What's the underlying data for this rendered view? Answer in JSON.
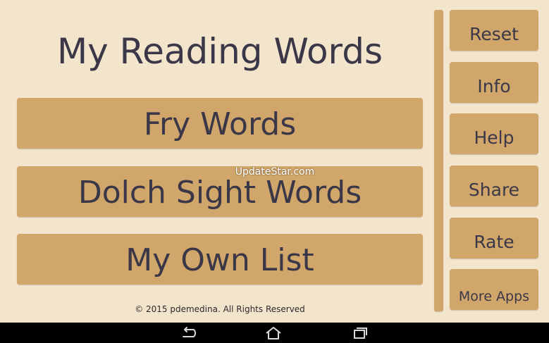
{
  "app": {
    "title": "My Reading Words",
    "main_buttons": [
      {
        "label": "Fry Words"
      },
      {
        "label": "Dolch Sight Words"
      },
      {
        "label": "My Own List"
      }
    ],
    "watermark": "UpdateStar.com",
    "copyright": "© 2015 pdemedina. All Rights Reserved"
  },
  "sidebar": {
    "buttons": [
      {
        "label": "Reset"
      },
      {
        "label": "Info"
      },
      {
        "label": "Help"
      },
      {
        "label": "Share"
      },
      {
        "label": "Rate"
      },
      {
        "label": "More Apps"
      }
    ]
  },
  "navbar": {
    "icons": [
      "back-icon",
      "home-icon",
      "recent-apps-icon"
    ]
  },
  "colors": {
    "background": "#f3e4cc",
    "button": "#d1a66a",
    "text": "#3a3848",
    "navbar": "#000000"
  }
}
